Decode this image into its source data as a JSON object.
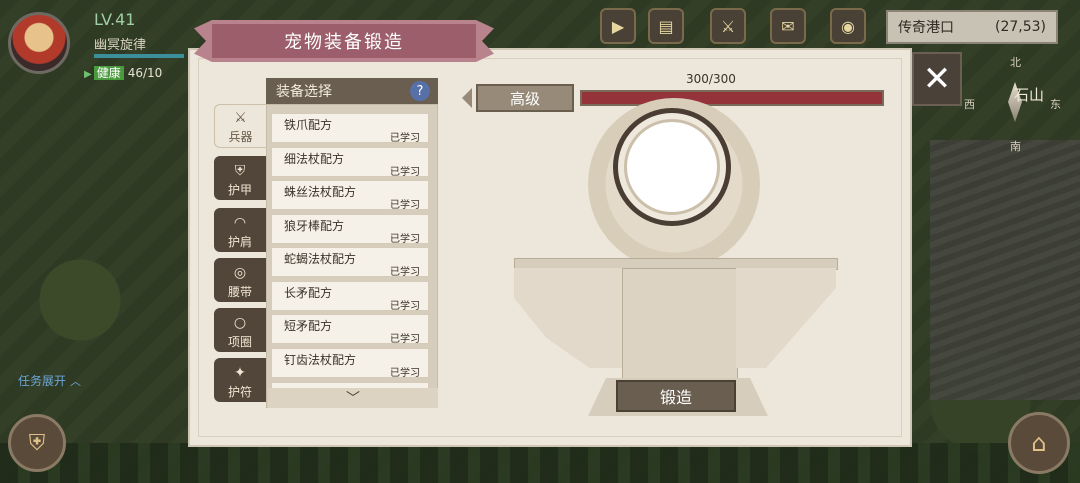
{
  "player": {
    "level": "LV.41",
    "name": "幽冥旋律",
    "hp_tag": "健康",
    "hp_value": "46/10"
  },
  "task_toggle": "任务展开",
  "location": {
    "name": "传奇港口",
    "coords": "(27,53)"
  },
  "compass": {
    "north": "北",
    "south": "南",
    "west": "西",
    "east": "东",
    "place": "石山"
  },
  "panel": {
    "title": "宠物装备锻造",
    "list_header": "装备选择",
    "help": "?",
    "grade": "高级",
    "progress_text": "300/300",
    "progress_fraction": 1.0,
    "forge_label": "锻造",
    "close": "✕"
  },
  "tabs": [
    {
      "label": "兵器",
      "icon": "sword-icon",
      "glyph": "⚔",
      "active": true
    },
    {
      "label": "护甲",
      "icon": "armor-icon",
      "glyph": "⛨",
      "active": false
    },
    {
      "label": "护肩",
      "icon": "shoulder-icon",
      "glyph": "◠",
      "active": false
    },
    {
      "label": "腰带",
      "icon": "belt-icon",
      "glyph": "◎",
      "active": false
    },
    {
      "label": "项圈",
      "icon": "collar-icon",
      "glyph": "○",
      "active": false
    },
    {
      "label": "护符",
      "icon": "charm-icon",
      "glyph": "✦",
      "active": false
    }
  ],
  "recipes": [
    {
      "name": "铁爪配方",
      "status": "已学习"
    },
    {
      "name": "细法杖配方",
      "status": "已学习"
    },
    {
      "name": "蛛丝法杖配方",
      "status": "已学习"
    },
    {
      "name": "狼牙棒配方",
      "status": "已学习"
    },
    {
      "name": "蛇蝎法杖配方",
      "status": "已学习"
    },
    {
      "name": "长矛配方",
      "status": "已学习"
    },
    {
      "name": "短矛配方",
      "status": "已学习"
    },
    {
      "name": "钉齿法杖配方",
      "status": "已学习"
    }
  ],
  "colors": {
    "accent": "#94333a",
    "banner": "#b8838c",
    "panel_bg": "#ede6da"
  }
}
